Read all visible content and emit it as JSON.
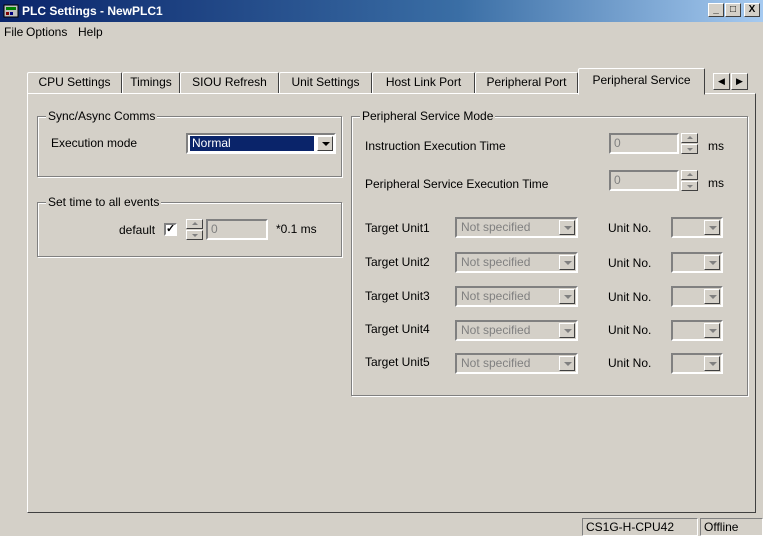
{
  "window": {
    "title": "PLC Settings - NewPLC1",
    "minimize": "_",
    "maximize": "□",
    "close": "X"
  },
  "menu": [
    "File",
    "Options",
    "Help"
  ],
  "tabs": [
    {
      "label": "CPU Settings"
    },
    {
      "label": "Timings"
    },
    {
      "label": "SIOU Refresh"
    },
    {
      "label": "Unit Settings"
    },
    {
      "label": "Host Link Port"
    },
    {
      "label": "Peripheral Port"
    },
    {
      "label": "Peripheral Service",
      "active": true
    }
  ],
  "tab_scroll": {
    "left": "◀",
    "right": "▶"
  },
  "sync_async": {
    "title": "Sync/Async Comms",
    "execution_mode_label": "Execution mode",
    "execution_mode_value": "Normal"
  },
  "set_time": {
    "title": "Set time to all events",
    "default_label": "default",
    "default_checked": "✓",
    "value": "0",
    "unit": "*0.1 ms"
  },
  "peripheral_service_mode": {
    "title": "Peripheral Service Mode",
    "instruction_label": "Instruction Execution Time",
    "instruction_value": "0",
    "instruction_unit": "ms",
    "peripheral_label": "Peripheral Service Execution Time",
    "peripheral_value": "0",
    "peripheral_unit": "ms",
    "unit_no_label": "Unit No.",
    "targets": [
      {
        "label": "Target Unit1",
        "value": "Not specified",
        "unit_no": ""
      },
      {
        "label": "Target Unit2",
        "value": "Not specified",
        "unit_no": ""
      },
      {
        "label": "Target Unit3",
        "value": "Not specified",
        "unit_no": ""
      },
      {
        "label": "Target Unit4",
        "value": "Not specified",
        "unit_no": ""
      },
      {
        "label": "Target Unit5",
        "value": "Not specified",
        "unit_no": ""
      }
    ]
  },
  "status": {
    "model": "CS1G-H-CPU42",
    "mode": "Offline"
  },
  "colors": {
    "face": "#d4d0c8",
    "title_start": "#0a246a",
    "title_end": "#a6caf0",
    "selection": "#0a246a"
  }
}
